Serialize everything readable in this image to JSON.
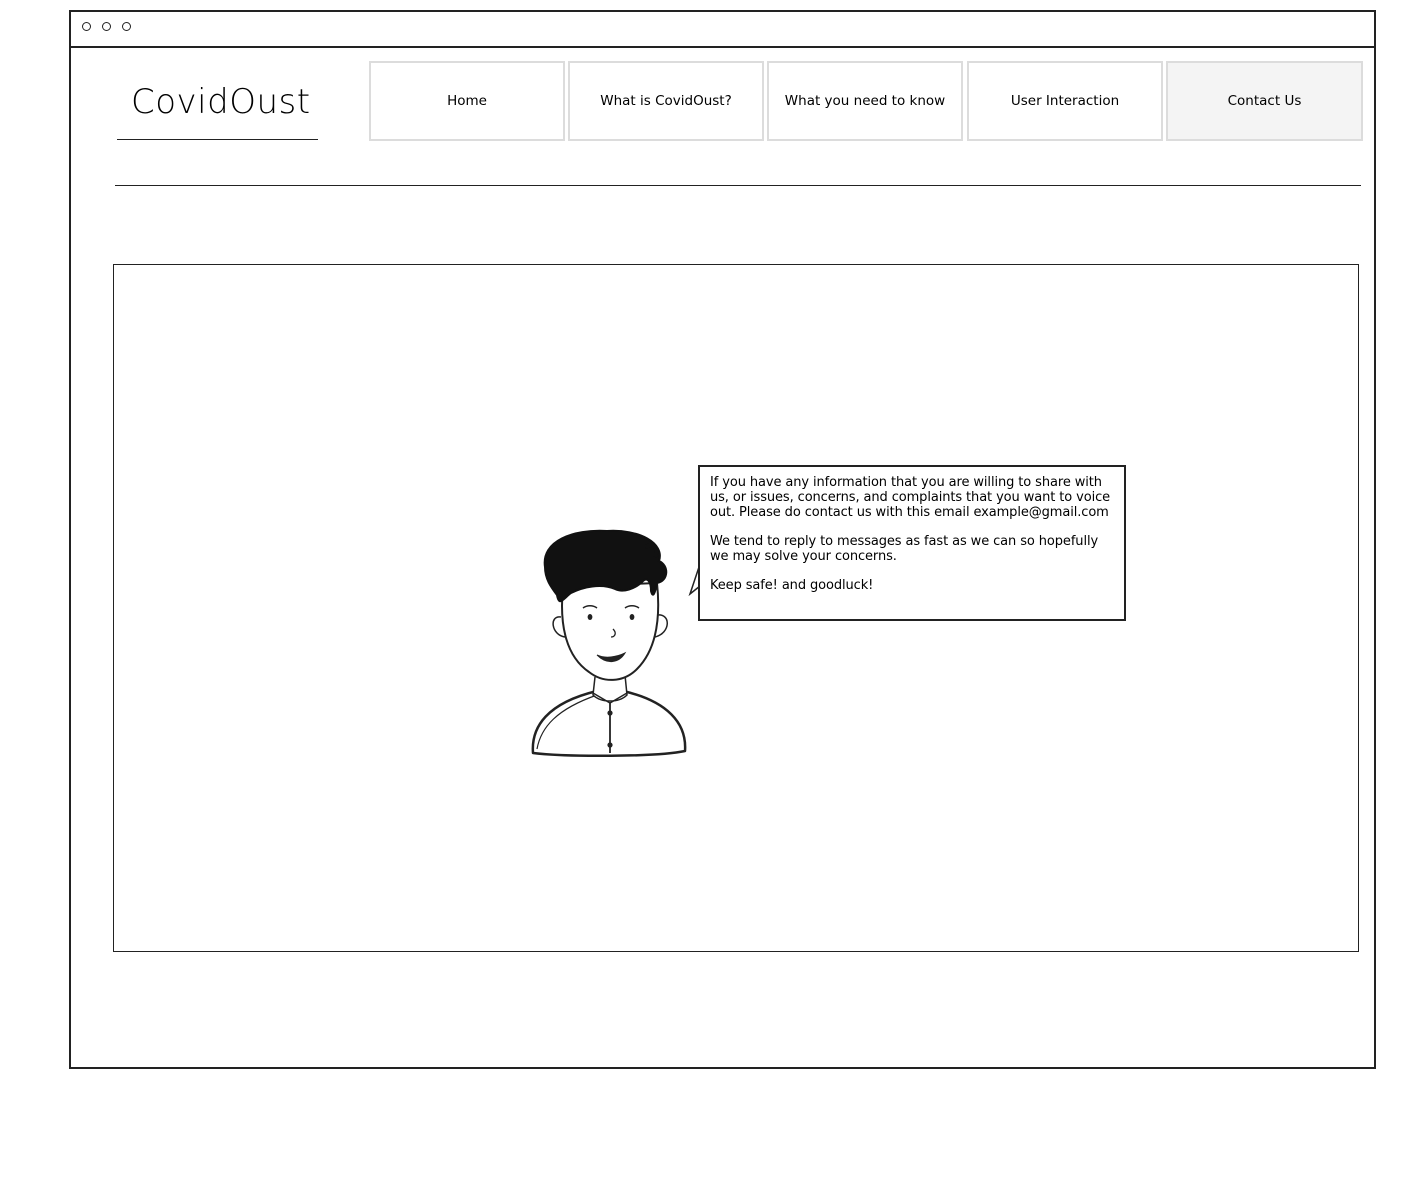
{
  "app": {
    "logo_text": "CovidOust"
  },
  "nav": {
    "tabs": [
      {
        "label": "Home",
        "active": false
      },
      {
        "label": "What is CovidOust?",
        "active": false
      },
      {
        "label": "What you need to know",
        "active": false
      },
      {
        "label": "User Interaction",
        "active": false
      },
      {
        "label": "Contact Us",
        "active": true
      }
    ]
  },
  "contact": {
    "paragraph_1": "If you have any information that you are willing to share with us, or issues, concerns, and complaints that you want to voice out. Please do contact us with this email example@gmail.com",
    "paragraph_2": "We tend to reply to messages as fast as we can so hopefully we may solve your concerns.",
    "paragraph_3": "Keep safe! and goodluck!"
  },
  "icons": {
    "window_controls": [
      "window-dot-icon",
      "window-dot-icon",
      "window-dot-icon"
    ],
    "avatar": "person-avatar-icon"
  },
  "colors": {
    "stroke": "#222222",
    "tab_border": "#dcdcdc",
    "active_tab_background": "#f4f4f4"
  }
}
